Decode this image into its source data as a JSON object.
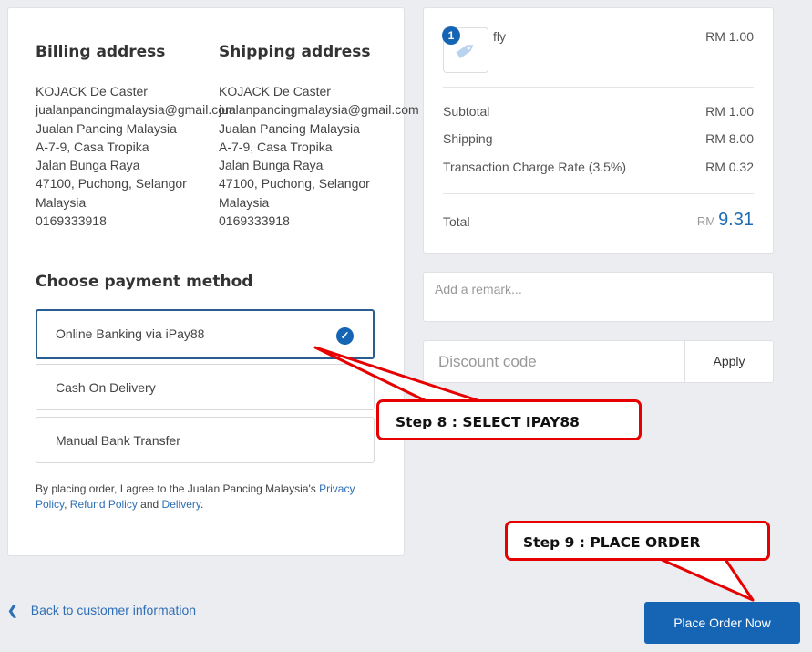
{
  "billing": {
    "heading": "Billing address",
    "lines": [
      "KOJACK De Caster",
      "jualanpancingmalaysia@gmail.com",
      "Jualan Pancing Malaysia",
      "A-7-9, Casa Tropika",
      "Jalan Bunga Raya",
      "47100, Puchong, Selangor",
      "Malaysia",
      "0169333918"
    ]
  },
  "shipping": {
    "heading": "Shipping address",
    "lines": [
      "KOJACK De Caster",
      "jualanpancingmalaysia@gmail.com",
      "Jualan Pancing Malaysia",
      "A-7-9, Casa Tropika",
      "Jalan Bunga Raya",
      "47100, Puchong, Selangor",
      "Malaysia",
      "0169333918"
    ]
  },
  "payment": {
    "title": "Choose payment method",
    "options": [
      "Online Banking via iPay88",
      "Cash On Delivery",
      "Manual Bank Transfer"
    ],
    "selected": "Online Banking via iPay88"
  },
  "terms": {
    "prefix": "By placing order, I agree to the Jualan Pancing Malaysia's ",
    "privacy": "Privacy Policy",
    "comma": ", ",
    "refund": "Refund Policy",
    "and": " and ",
    "delivery": "Delivery",
    "end": "."
  },
  "summary": {
    "item": {
      "qty": "1",
      "name": "fly",
      "price": "RM 1.00",
      "icon": "tag-icon"
    },
    "subtotal_label": "Subtotal",
    "subtotal_value": "RM 1.00",
    "shipping_label": "Shipping",
    "shipping_value": "RM 8.00",
    "charge_label": "Transaction Charge Rate (3.5%)",
    "charge_value": "RM 0.32",
    "total_label": "Total",
    "total_currency": "RM",
    "total_value": "9.31"
  },
  "remark": {
    "placeholder": "Add a remark..."
  },
  "discount": {
    "placeholder": "Discount code",
    "apply": "Apply"
  },
  "back_link": "Back to customer information",
  "place_order": "Place Order Now",
  "annotations": {
    "step8": "Step 8 : SELECT IPAY88",
    "step9": "Step 9 : PLACE ORDER"
  },
  "colors": {
    "accent": "#1565b4",
    "annotation": "#e60000",
    "background": "#ecedf0"
  }
}
